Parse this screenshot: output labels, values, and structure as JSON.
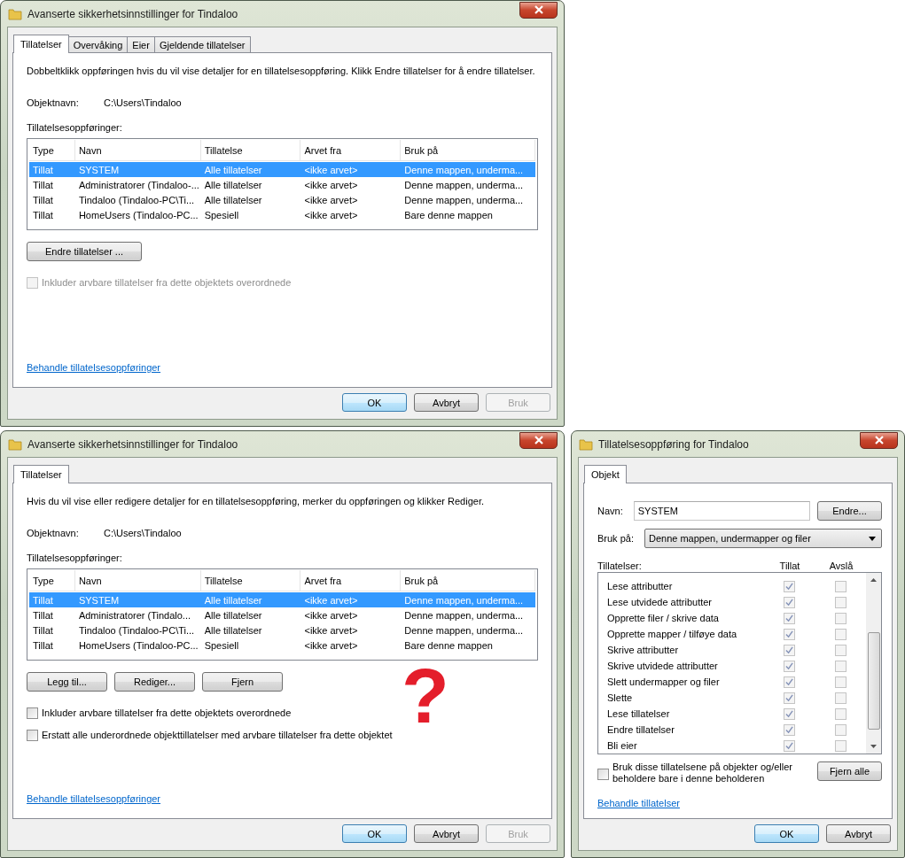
{
  "dialogs": [
    {
      "kind": "advanced",
      "title": "Avanserte sikkerhetsinnstillinger for Tindaloo",
      "tabs": [
        {
          "label": "Tillatelser",
          "selected": true
        },
        {
          "label": "Overvåking",
          "selected": false
        },
        {
          "label": "Eier",
          "selected": false
        },
        {
          "label": "Gjeldende tillatelser",
          "selected": false
        }
      ],
      "description": "Dobbeltklikk oppføringen hvis du vil vise detaljer for en tillatelsesoppføring. Klikk Endre tillatelser for å endre tillatelser.",
      "object_label": "Objektnavn:",
      "object_value": "C:\\Users\\Tindaloo",
      "list_label": "Tillatelsesoppføringer:",
      "columns": [
        "Type",
        "Navn",
        "Tillatelse",
        "Arvet fra",
        "Bruk på"
      ],
      "rows": [
        {
          "cells": [
            "Tillat",
            "SYSTEM",
            "Alle tillatelser",
            "<ikke arvet>",
            "Denne mappen, underma..."
          ],
          "selected": true
        },
        {
          "cells": [
            "Tillat",
            "Administratorer (Tindaloo-...",
            "Alle tillatelser",
            "<ikke arvet>",
            "Denne mappen, underma..."
          ],
          "selected": false
        },
        {
          "cells": [
            "Tillat",
            "Tindaloo (Tindaloo-PC\\Ti...",
            "Alle tillatelser",
            "<ikke arvet>",
            "Denne mappen, underma..."
          ],
          "selected": false
        },
        {
          "cells": [
            "Tillat",
            "HomeUsers (Tindaloo-PC...",
            "Spesiell",
            "<ikke arvet>",
            "Bare denne mappen"
          ],
          "selected": false
        }
      ],
      "buttons": [
        {
          "label": "Endre tillatelser ..."
        }
      ],
      "checkboxes": [
        {
          "label": "Inkluder arvbare tillatelser fra dette objektets overordnede",
          "checked": false,
          "disabled": true
        }
      ],
      "link": "Behandle tillatelsesoppføringer",
      "footer": [
        {
          "label": "OK",
          "default": true,
          "disabled": false
        },
        {
          "label": "Avbryt",
          "default": false,
          "disabled": false
        },
        {
          "label": "Bruk",
          "default": false,
          "disabled": true
        }
      ]
    },
    {
      "kind": "advanced",
      "title": "Avanserte sikkerhetsinnstillinger for Tindaloo",
      "tabs": [
        {
          "label": "Tillatelser",
          "selected": true
        }
      ],
      "description": "Hvis du vil vise eller redigere detaljer for en tillatelsesoppføring, merker du oppføringen og klikker Rediger.",
      "object_label": "Objektnavn:",
      "object_value": "C:\\Users\\Tindaloo",
      "list_label": "Tillatelsesoppføringer:",
      "columns": [
        "Type",
        "Navn",
        "Tillatelse",
        "Arvet fra",
        "Bruk på"
      ],
      "rows": [
        {
          "cells": [
            "Tillat",
            "SYSTEM",
            "Alle tillatelser",
            "<ikke arvet>",
            "Denne mappen, underma..."
          ],
          "selected": true
        },
        {
          "cells": [
            "Tillat",
            "Administratorer (Tindalo...",
            "Alle tillatelser",
            "<ikke arvet>",
            "Denne mappen, underma..."
          ],
          "selected": false
        },
        {
          "cells": [
            "Tillat",
            "Tindaloo (Tindaloo-PC\\Ti...",
            "Alle tillatelser",
            "<ikke arvet>",
            "Denne mappen, underma..."
          ],
          "selected": false
        },
        {
          "cells": [
            "Tillat",
            "HomeUsers (Tindaloo-PC...",
            "Spesiell",
            "<ikke arvet>",
            "Bare denne mappen"
          ],
          "selected": false
        }
      ],
      "buttons": [
        {
          "label": "Legg til..."
        },
        {
          "label": "Rediger..."
        },
        {
          "label": "Fjern"
        }
      ],
      "checkboxes": [
        {
          "label": "Inkluder arvbare tillatelser fra dette objektets overordnede",
          "checked": false,
          "disabled": false
        },
        {
          "label": "Erstatt alle underordnede objekttillatelser med arvbare tillatelser fra dette objektet",
          "checked": false,
          "disabled": false
        }
      ],
      "link": "Behandle tillatelsesoppføringer",
      "footer": [
        {
          "label": "OK",
          "default": true,
          "disabled": false
        },
        {
          "label": "Avbryt",
          "default": false,
          "disabled": false
        },
        {
          "label": "Bruk",
          "default": false,
          "disabled": true
        }
      ]
    },
    {
      "kind": "entry",
      "title": "Tillatelsesoppføring for Tindaloo",
      "tabs": [
        {
          "label": "Objekt",
          "selected": true
        }
      ],
      "name_label": "Navn:",
      "name_value": "SYSTEM",
      "change_button": "Endre...",
      "apply_label": "Bruk på:",
      "apply_value": "Denne mappen, undermapper og filer",
      "perm_label": "Tillatelser:",
      "allow_label": "Tillat",
      "deny_label": "Avslå",
      "perms_disabled": true,
      "perms": [
        {
          "name": "Lese attributter",
          "allow": true,
          "deny": false
        },
        {
          "name": "Lese utvidede attributter",
          "allow": true,
          "deny": false
        },
        {
          "name": "Opprette filer / skrive data",
          "allow": true,
          "deny": false
        },
        {
          "name": "Opprette mapper / tilføye data",
          "allow": true,
          "deny": false
        },
        {
          "name": "Skrive attributter",
          "allow": true,
          "deny": false
        },
        {
          "name": "Skrive utvidede attributter",
          "allow": true,
          "deny": false
        },
        {
          "name": "Slett undermapper og filer",
          "allow": true,
          "deny": false
        },
        {
          "name": "Slette",
          "allow": true,
          "deny": false
        },
        {
          "name": "Lese tillatelser",
          "allow": true,
          "deny": false
        },
        {
          "name": "Endre tillatelser",
          "allow": true,
          "deny": false
        },
        {
          "name": "Bli eier",
          "allow": true,
          "deny": false
        }
      ],
      "checkbox": {
        "label": "Bruk disse tillatelsene på objekter og/eller beholdere bare i denne beholderen",
        "checked": false
      },
      "clear_button": "Fjern alle",
      "link": "Behandle tillatelser",
      "footer": [
        {
          "label": "OK",
          "default": true,
          "disabled": false
        },
        {
          "label": "Avbryt",
          "default": false,
          "disabled": false
        }
      ]
    }
  ],
  "annotation": "?"
}
